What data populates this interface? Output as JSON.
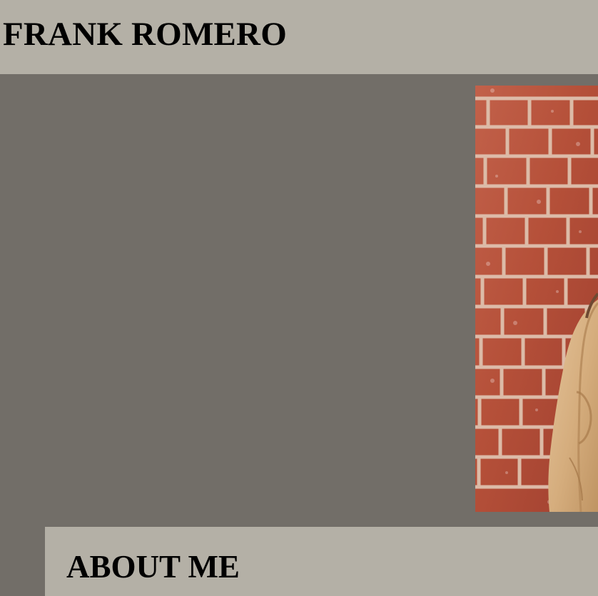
{
  "header": {
    "title": "FRANK ROMERO"
  },
  "hero": {
    "image_icon": "portrait-photo-brick-wall"
  },
  "about": {
    "heading": "ABOUT ME"
  },
  "colors": {
    "background": "#726e68",
    "panel": "#b4b0a6",
    "text": "#000000",
    "brick": "#b9553f",
    "mortar": "#d6b5a4",
    "jacket": "#d8b385"
  }
}
